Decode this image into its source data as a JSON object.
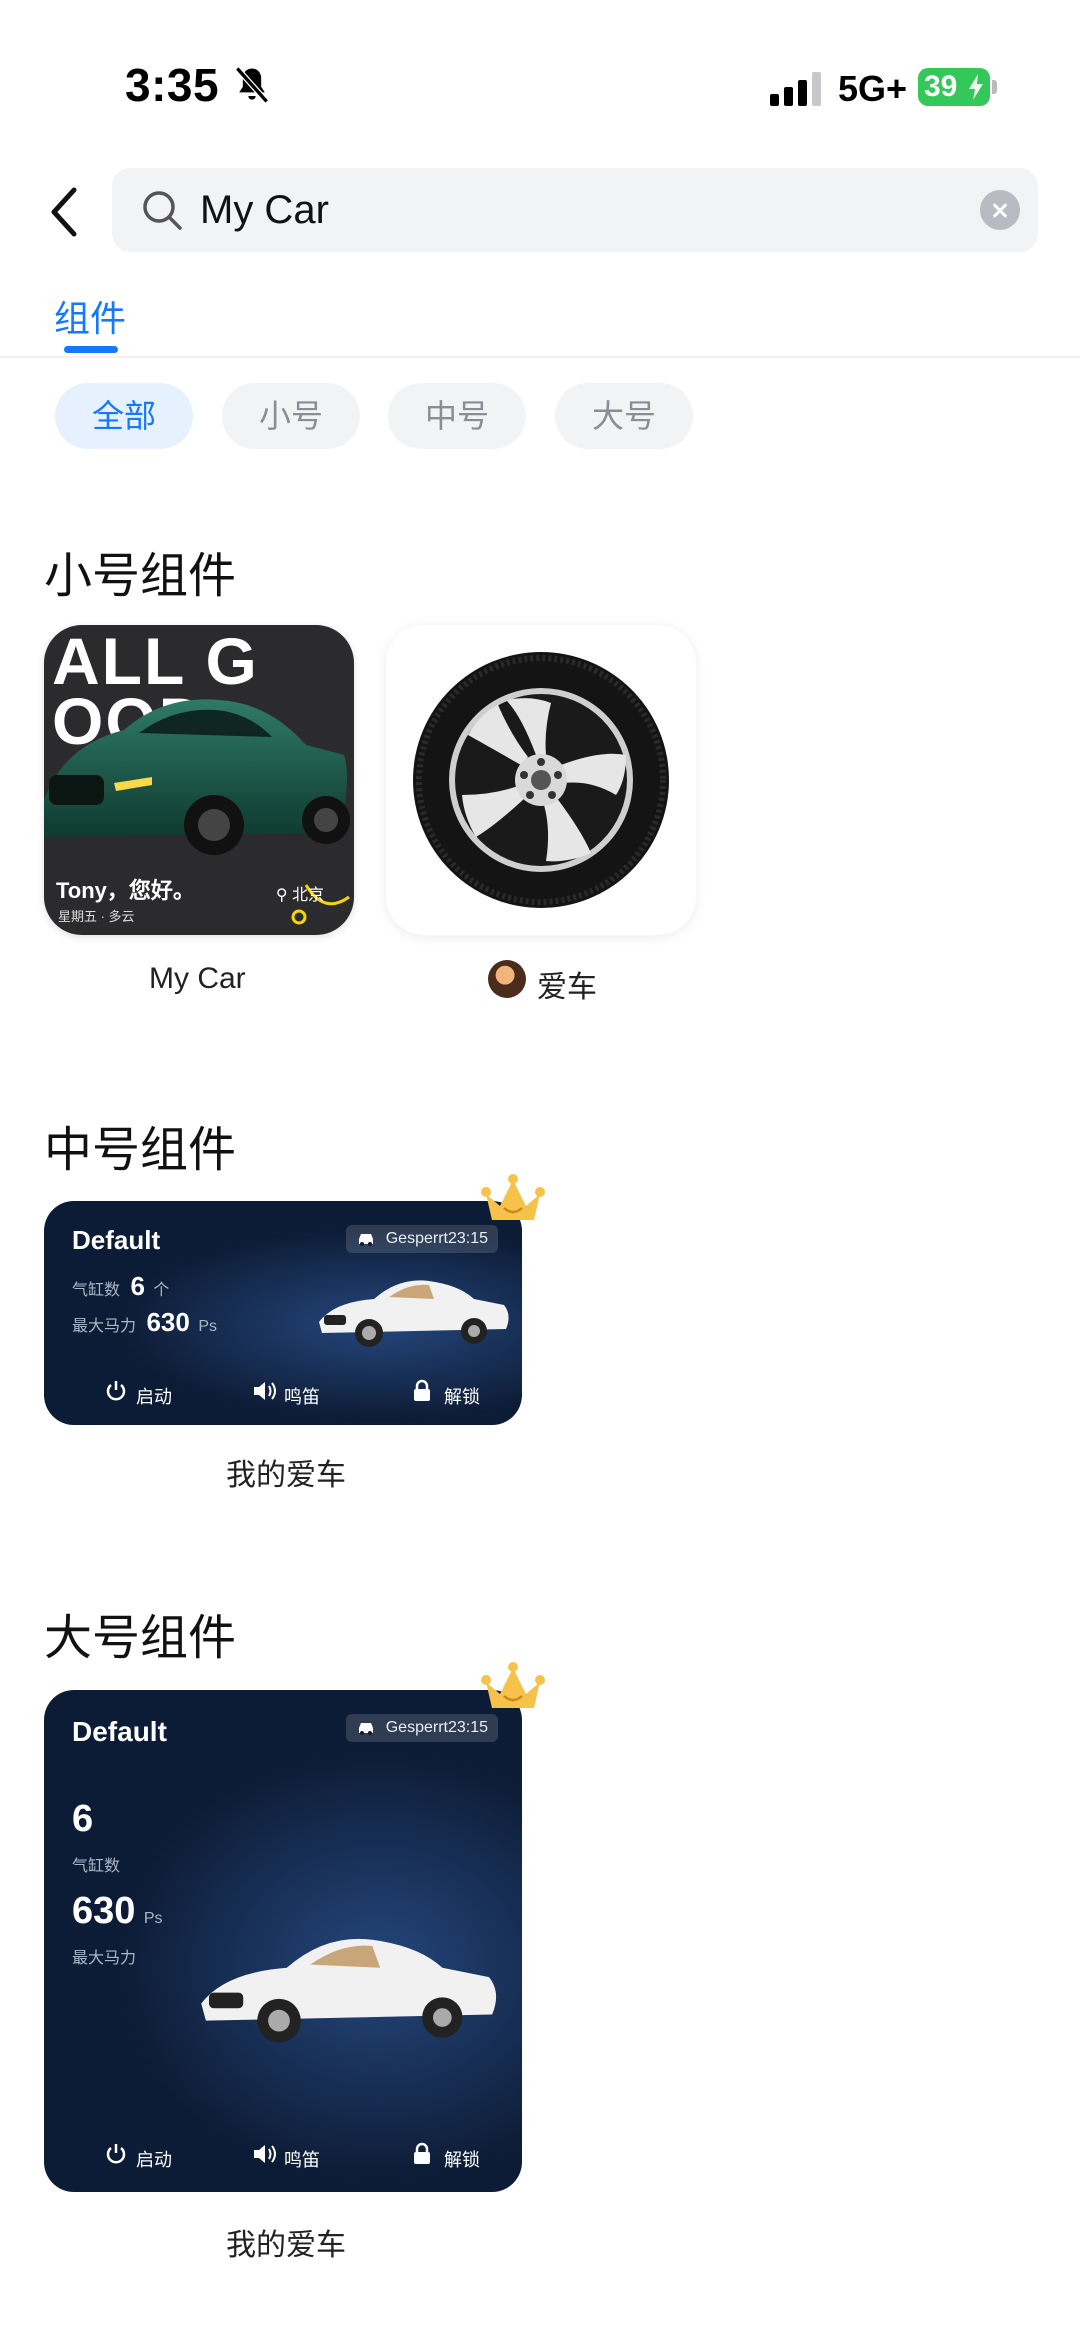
{
  "status_bar": {
    "time": "3:35",
    "network": "5G+",
    "battery": "39"
  },
  "search": {
    "value": "My Car"
  },
  "tabs": [
    {
      "label": "组件"
    }
  ],
  "filters": [
    {
      "label": "全部",
      "active": true
    },
    {
      "label": "小号"
    },
    {
      "label": "中号"
    },
    {
      "label": "大号"
    }
  ],
  "sections": {
    "small": {
      "title": "小号组件",
      "widgets": [
        {
          "label": "My Car",
          "art_text": "ALL GOOD",
          "greeting": "Tony，您好。",
          "sub": "星期五 · 多云",
          "location": "北京"
        },
        {
          "label": "爱车",
          "icon": "tire-icon"
        }
      ]
    },
    "medium": {
      "title": "中号组件",
      "widget": {
        "label": "我的爱车",
        "name": "Default",
        "tag": "Gesperrt23:15",
        "cyl_label": "气缸数",
        "cyl_value": "6",
        "cyl_unit": "个",
        "hp_label": "最大马力",
        "hp_value": "630",
        "hp_unit": "Ps",
        "actions": [
          "启动",
          "鸣笛",
          "解锁"
        ]
      }
    },
    "large": {
      "title": "大号组件",
      "widget": {
        "label": "我的爱车",
        "name": "Default",
        "tag": "Gesperrt23:15",
        "cyl_value": "6",
        "cyl_label": "气缸数",
        "hp_value": "630",
        "hp_unit": "Ps",
        "hp_label": "最大马力",
        "actions": [
          "启动",
          "鸣笛",
          "解锁"
        ]
      }
    }
  }
}
